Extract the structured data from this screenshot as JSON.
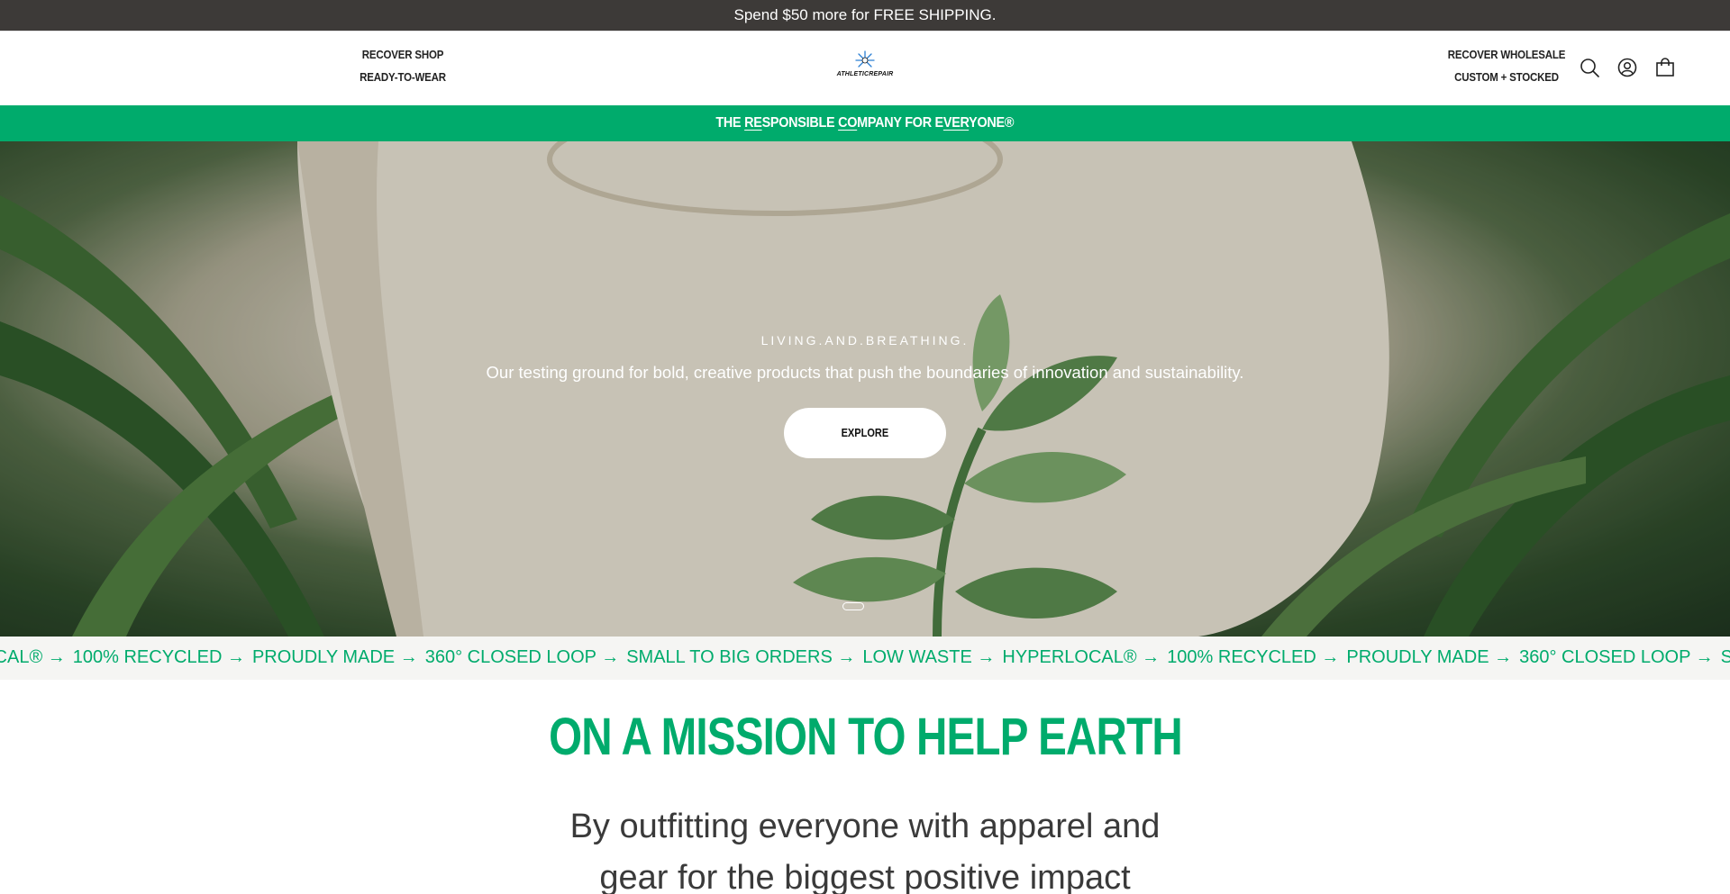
{
  "announcement": {
    "text": "Spend $50 more for FREE SHIPPING."
  },
  "header": {
    "left_nav": [
      "RECOVER SHOP",
      "READY-TO-WEAR"
    ],
    "right_nav": [
      "RECOVER WHOLESALE",
      "CUSTOM + STOCKED"
    ],
    "logo_text": "ATHLETICREPAIR",
    "icons": [
      "search-icon",
      "account-icon",
      "bag-icon"
    ]
  },
  "tagline": {
    "parts": [
      "THE ",
      "RE",
      "SPONSIBLE ",
      "CO",
      "MPANY FOR E",
      "VER",
      "YONE®"
    ]
  },
  "hero": {
    "kicker": "LIVING.AND.BREATHING.",
    "subtitle": "Our testing ground for bold, creative products that push the boundaries of innovation and sustainability.",
    "button": "EXPLORE"
  },
  "marquee": {
    "items": [
      "OCAL® →",
      "100% RECYCLED →",
      "PROUDLY MADE →",
      "360° CLOSED LOOP →",
      "SMALL TO BIG ORDERS →",
      "LOW WASTE →",
      "HYPERLOCAL® →",
      "100% RECYCLED →",
      "PROUDLY MADE →",
      "360° CLOSED LOOP →",
      "SMALL TO BIG ORDERS"
    ]
  },
  "mission": {
    "title": "ON A MISSION TO HELP EARTH",
    "line1": "By outfitting everyone with apparel and",
    "line2": "gear for the biggest positive impact"
  },
  "colors": {
    "brand_green": "#00ab6c",
    "announce_bg": "#3d3a38"
  }
}
